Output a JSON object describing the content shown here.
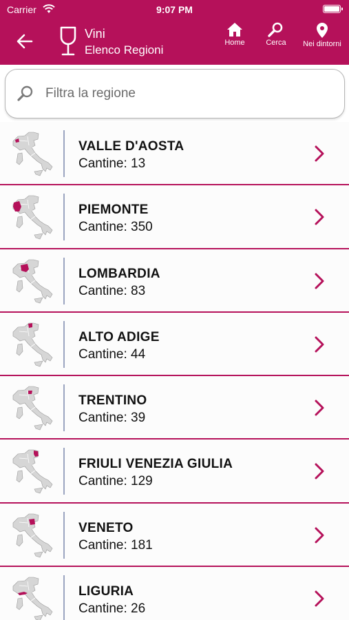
{
  "status_bar": {
    "carrier": "Carrier",
    "time": "9:07 PM"
  },
  "header": {
    "title": "Vini",
    "subtitle": "Elenco Regioni",
    "nav": [
      {
        "label": "Home",
        "icon": "home-icon"
      },
      {
        "label": "Cerca",
        "icon": "search-icon"
      },
      {
        "label": "Nei dintorni",
        "icon": "location-pin-icon"
      }
    ]
  },
  "search": {
    "placeholder": "Filtra la regione",
    "value": ""
  },
  "regions": [
    {
      "name": "VALLE D'AOSTA",
      "count": "Cantine: 13"
    },
    {
      "name": "PIEMONTE",
      "count": "Cantine: 350"
    },
    {
      "name": "LOMBARDIA",
      "count": "Cantine: 83"
    },
    {
      "name": "ALTO ADIGE",
      "count": "Cantine: 44"
    },
    {
      "name": "TRENTINO",
      "count": "Cantine: 39"
    },
    {
      "name": "FRIULI VENEZIA GIULIA",
      "count": "Cantine: 129"
    },
    {
      "name": "VENETO",
      "count": "Cantine: 181"
    },
    {
      "name": "LIGURIA",
      "count": "Cantine: 26"
    }
  ],
  "colors": {
    "accent": "#b5115a",
    "map_gray": "#d6d6d6",
    "separator": "#9aa4c0"
  }
}
